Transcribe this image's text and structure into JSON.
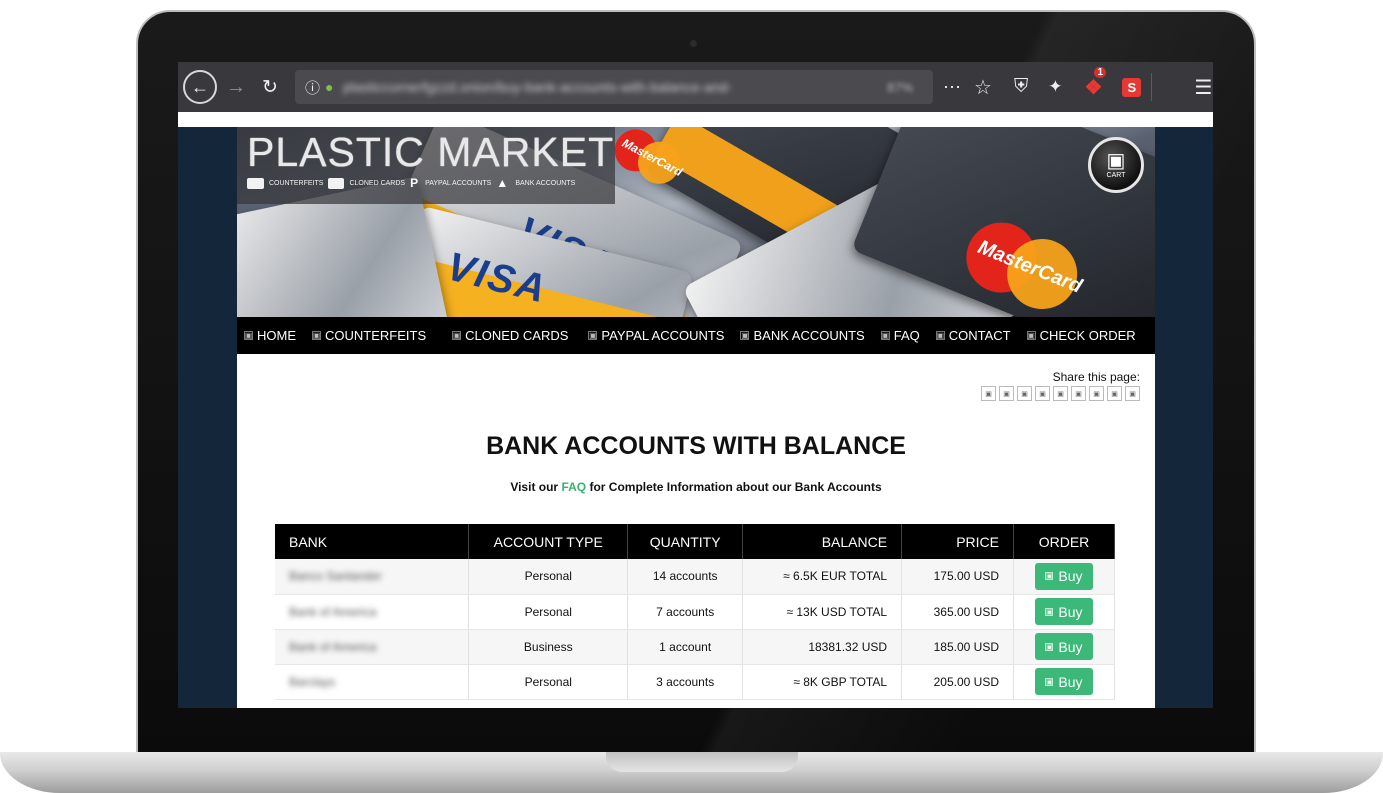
{
  "browser": {
    "url_text": "plasticcornerfgzzd.onion/buy-bank-accounts-with-balance-and-",
    "zoom": "87%",
    "ext_badge": "1",
    "ext_s_label": "S"
  },
  "site": {
    "logo": "PLASTIC MARKET",
    "logo_categories": [
      "COUNTERFEITS",
      "CLONED CARDS",
      "PAYPAL ACCOUNTS",
      "BANK ACCOUNTS"
    ],
    "cart_label": "CART",
    "banner_visa": "VISA",
    "banner_mastercard": "MasterCard"
  },
  "nav": {
    "items": [
      "HOME",
      "COUNTERFEITS",
      "CLONED CARDS",
      "PAYPAL ACCOUNTS",
      "BANK ACCOUNTS",
      "FAQ",
      "CONTACT",
      "CHECK ORDER"
    ]
  },
  "share": {
    "label": "Share this page:"
  },
  "main": {
    "title": "BANK ACCOUNTS WITH BALANCE",
    "subtitle_pre": "Visit our ",
    "subtitle_link": "FAQ",
    "subtitle_post": " for Complete Information about our Bank Accounts"
  },
  "table": {
    "headers": [
      "BANK",
      "ACCOUNT TYPE",
      "QUANTITY",
      "BALANCE",
      "PRICE",
      "ORDER"
    ],
    "rows": [
      {
        "bank": "Banco Santander",
        "type": "Personal",
        "quantity": "14 accounts",
        "balance": "≈ 6.5K EUR TOTAL",
        "price": "175.00 USD",
        "order": "Buy"
      },
      {
        "bank": "Bank of America",
        "type": "Personal",
        "quantity": "7 accounts",
        "balance": "≈ 13K USD TOTAL",
        "price": "365.00 USD",
        "order": "Buy"
      },
      {
        "bank": "Bank of America",
        "type": "Business",
        "quantity": "1 account",
        "balance": "18381.32 USD",
        "price": "185.00 USD",
        "order": "Buy"
      },
      {
        "bank": "Barclays",
        "type": "Personal",
        "quantity": "3 accounts",
        "balance": "≈ 8K GBP TOTAL",
        "price": "205.00 USD",
        "order": "Buy"
      }
    ]
  },
  "colors": {
    "buy_button": "#3cb878",
    "faq_link": "#37b36d",
    "nav_bg": "#000000",
    "browser_toolbar": "#38383d"
  }
}
